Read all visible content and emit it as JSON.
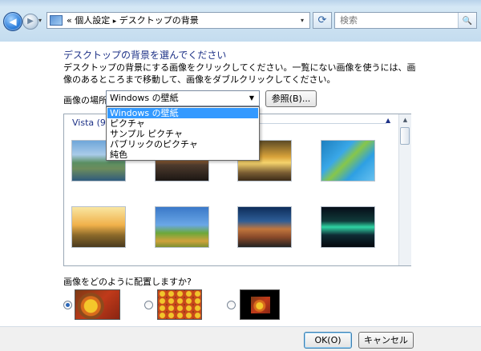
{
  "window": {
    "breadcrumb_prefix": "«",
    "breadcrumb_1": "個人設定",
    "breadcrumb_sep": "▸",
    "breadcrumb_2": "デスクトップの背景",
    "search_placeholder": "検索"
  },
  "icons": {
    "back": "◀",
    "forward": "▶",
    "dropdown": "▾",
    "refresh": "⟳",
    "search": "🔍",
    "select_arrow": "▼",
    "collapse": "▲",
    "scroll_up": "▲"
  },
  "main": {
    "heading": "デスクトップの背景を選んでください",
    "description": "デスクトップの背景にする画像をクリックしてください。一覧にない画像を使うには、画像のあるところまで移動して、画像をダブルクリックしてください。",
    "location_label": "画像の場所",
    "location_value": "Windows の壁紙",
    "browse_button": "参照(B)...",
    "location_options": [
      "Windows の壁紙",
      "ピクチャ",
      "サンプル ピクチャ",
      "パブリックのピクチャ",
      "純色"
    ],
    "gallery_group": "Vista (9)",
    "position_question": "画像をどのように配置しますか?",
    "position_selected": "fit-to-screen"
  },
  "footer": {
    "ok_button": "OK(O)",
    "cancel_button": "キャンセル"
  },
  "colors": {
    "heading": "#1e3287",
    "selection": "#3399ff"
  }
}
